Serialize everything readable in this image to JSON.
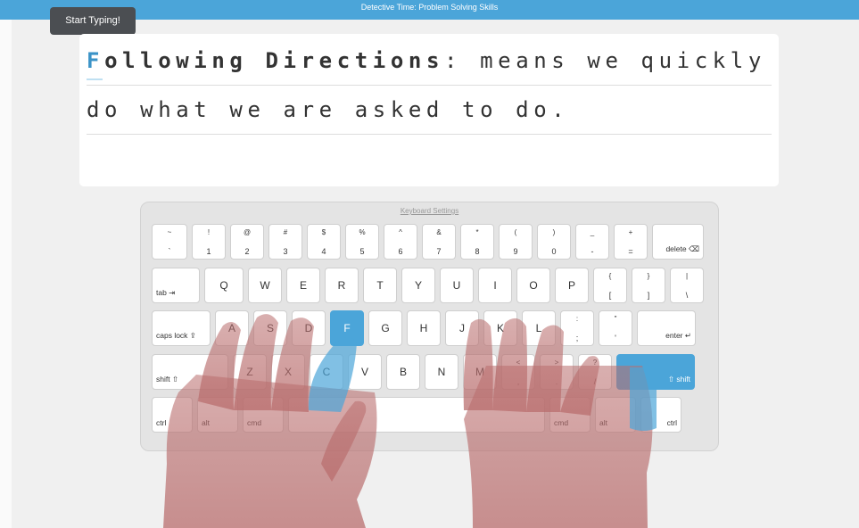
{
  "header": {
    "title": "Detective Time: Problem Solving Skills",
    "tooltip": "Start Typing!"
  },
  "lesson": {
    "line1": {
      "cursor_char": "F",
      "bold_rest": "ollowing Directions",
      "rest": ": means we quickly"
    },
    "line2": "do what we are asked to do."
  },
  "keyboard": {
    "settings_link": "Keyboard Settings",
    "active_color": "#4ba5d9",
    "active_keys": [
      "F",
      "right-shift"
    ],
    "rows": [
      [
        {
          "top": "~",
          "bottom": "`"
        },
        {
          "top": "!",
          "bottom": "1"
        },
        {
          "top": "@",
          "bottom": "2"
        },
        {
          "top": "#",
          "bottom": "3"
        },
        {
          "top": "$",
          "bottom": "4"
        },
        {
          "top": "%",
          "bottom": "5"
        },
        {
          "top": "^",
          "bottom": "6"
        },
        {
          "top": "&",
          "bottom": "7"
        },
        {
          "top": "*",
          "bottom": "8"
        },
        {
          "top": "(",
          "bottom": "9"
        },
        {
          "top": ")",
          "bottom": "0"
        },
        {
          "top": "_",
          "bottom": "-"
        },
        {
          "top": "+",
          "bottom": "="
        },
        {
          "label": "delete ⌫"
        }
      ],
      [
        {
          "label": "tab ⇥"
        },
        {
          "center": "Q"
        },
        {
          "center": "W"
        },
        {
          "center": "E"
        },
        {
          "center": "R"
        },
        {
          "center": "T"
        },
        {
          "center": "Y"
        },
        {
          "center": "U"
        },
        {
          "center": "I"
        },
        {
          "center": "O"
        },
        {
          "center": "P"
        },
        {
          "top": "{",
          "bottom": "["
        },
        {
          "top": "}",
          "bottom": "]"
        },
        {
          "top": "|",
          "bottom": "\\"
        }
      ],
      [
        {
          "label": "caps lock ⇪"
        },
        {
          "center": "A"
        },
        {
          "center": "S"
        },
        {
          "center": "D"
        },
        {
          "center": "F"
        },
        {
          "center": "G"
        },
        {
          "center": "H"
        },
        {
          "center": "J"
        },
        {
          "center": "K"
        },
        {
          "center": "L"
        },
        {
          "top": ":",
          "bottom": ";"
        },
        {
          "top": "\"",
          "bottom": "'"
        },
        {
          "label": "enter ↵"
        }
      ],
      [
        {
          "label": "shift ⇧"
        },
        {
          "center": "Z"
        },
        {
          "center": "X"
        },
        {
          "center": "C"
        },
        {
          "center": "V"
        },
        {
          "center": "B"
        },
        {
          "center": "N"
        },
        {
          "center": "M"
        },
        {
          "top": "<",
          "bottom": ","
        },
        {
          "top": ">",
          "bottom": "."
        },
        {
          "top": "?",
          "bottom": "/"
        },
        {
          "label": "⇧ shift"
        }
      ],
      [
        {
          "label": "ctrl"
        },
        {
          "label": "alt"
        },
        {
          "label": "cmd"
        },
        {
          "label": ""
        },
        {
          "label": "cmd"
        },
        {
          "label": "alt"
        },
        {
          "label": "ctrl"
        }
      ]
    ]
  }
}
